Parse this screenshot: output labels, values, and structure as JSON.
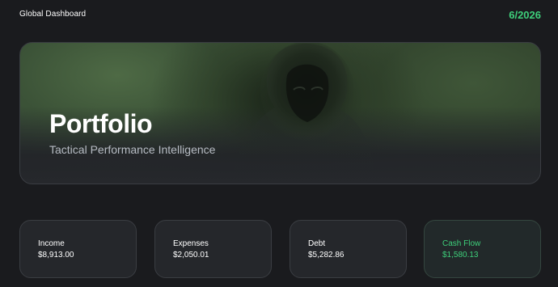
{
  "header": {
    "app_title": "Global Dashboard",
    "period": "6/2026"
  },
  "hero": {
    "title": "Portfolio",
    "subtitle": "Tactical Performance Intelligence",
    "image": "hooded-figure-image"
  },
  "cards": [
    {
      "label": "Income",
      "value": "$8,913.00"
    },
    {
      "label": "Expenses",
      "value": "$2,050.01"
    },
    {
      "label": "Debt",
      "value": "$5,282.86"
    },
    {
      "label": "Cash Flow",
      "value": "$1,580.13"
    }
  ],
  "colors": {
    "accent": "#3ecf7a",
    "background": "#1a1b1e",
    "card": "#25272b"
  }
}
